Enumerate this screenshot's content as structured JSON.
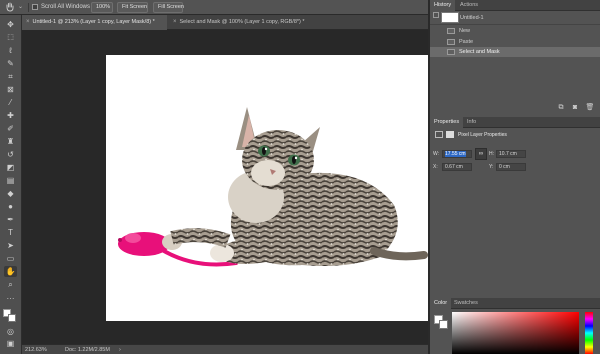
{
  "options_bar": {
    "scroll_all_windows_label": "Scroll All Windows",
    "zoom_button": "100%",
    "fit_screen_button": "Fit Screen",
    "fill_screen_button": "Fill Screen"
  },
  "document_tabs": [
    {
      "label": "Untitled-1 @ 213% (Layer 1 copy, Layer Mask/8) *",
      "close": "×"
    },
    {
      "label": "Select and Mask @ 100% (Layer 1 copy, RGB/8*) *",
      "close": "×"
    }
  ],
  "status_bar": {
    "zoom": "212.63%",
    "doc_info": "Doc: 1.22M/2.85M",
    "arrow": "›"
  },
  "history_panel": {
    "tabs": [
      "History",
      "Actions"
    ],
    "snapshot_name": "Untitled-1",
    "steps": [
      "New",
      "Paste",
      "Select and Mask"
    ],
    "selected_step": "Select and Mask"
  },
  "properties_panel": {
    "tabs": [
      "Properties",
      "Info"
    ],
    "title": "Pixel Layer Properties",
    "w_label": "W:",
    "w_value": "17.55 cm",
    "h_label": "H:",
    "h_value": "10.7 cm",
    "x_label": "X:",
    "x_value": "0.67 cm",
    "y_label": "Y:",
    "y_value": "0 cm",
    "link_icon": "link-icon"
  },
  "color_panel": {
    "tabs": [
      "Color",
      "Swatches"
    ],
    "hue_color": "#ff0000"
  }
}
